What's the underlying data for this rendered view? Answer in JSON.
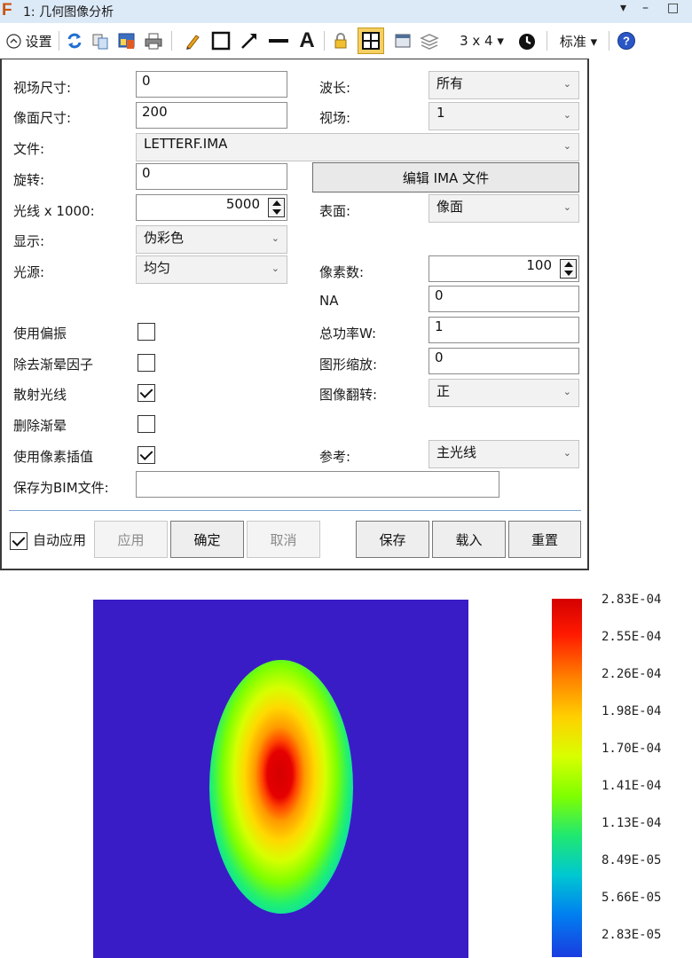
{
  "titlebar": {
    "app_icon": "F",
    "title": "1: 几何图像分析",
    "pin_glyph": "▾",
    "minimize_glyph": "–",
    "maximize_glyph": "□"
  },
  "toolbar": {
    "settings_label": "设置",
    "layout_label": "3 x 4 ▾",
    "standard_label": "标准 ▾",
    "text_tool_glyph": "A"
  },
  "form": {
    "field_size_label": "视场尺寸:",
    "field_size_value": "0",
    "wavelength_label": "波长:",
    "wavelength_value": "所有",
    "image_size_label": "像面尺寸:",
    "image_size_value": "200",
    "field_label": "视场:",
    "field_value": "1",
    "file_label": "文件:",
    "file_value": "LETTERF.IMA",
    "rotation_label": "旋转:",
    "rotation_value": "0",
    "edit_ima_label": "编辑 IMA 文件",
    "rays_label": "光线 x 1000:",
    "rays_value": "5000",
    "surface_label": "表面:",
    "surface_value": "像面",
    "display_label": "显示:",
    "display_value": "伪彩色",
    "source_label": "光源:",
    "source_value": "均匀",
    "pixels_label": "像素数:",
    "pixels_value": "100",
    "na_label": "NA",
    "na_value": "0",
    "total_power_label": "总功率W:",
    "total_power_value": "1",
    "plot_scale_label": "图形缩放:",
    "plot_scale_value": "0",
    "image_flip_label": "图像翻转:",
    "image_flip_value": "正",
    "reference_label": "参考:",
    "reference_value": "主光线",
    "use_polarization_label": "使用偏振",
    "use_polarization_checked": false,
    "remove_vignetting_label": "除去渐晕因子",
    "remove_vignetting_checked": false,
    "scatter_rays_label": "散射光线",
    "scatter_rays_checked": true,
    "delete_vignetted_label": "删除渐晕",
    "delete_vignetted_checked": false,
    "use_pixel_interp_label": "使用像素插值",
    "use_pixel_interp_checked": true,
    "save_bim_label": "保存为BIM文件:",
    "save_bim_value": ""
  },
  "actions": {
    "auto_apply_label": "自动应用",
    "auto_apply_checked": true,
    "apply_label": "应用",
    "ok_label": "确定",
    "cancel_label": "取消",
    "save_label": "保存",
    "load_label": "载入",
    "reset_label": "重置"
  },
  "colorbar": {
    "ticks": [
      "2.83E-04",
      "2.55E-04",
      "2.26E-04",
      "1.98E-04",
      "1.70E-04",
      "1.41E-04",
      "1.13E-04",
      "8.49E-05",
      "5.66E-05",
      "2.83E-05"
    ],
    "colors": {
      "background": "#3a1cc6",
      "peak": "#d40000"
    }
  }
}
